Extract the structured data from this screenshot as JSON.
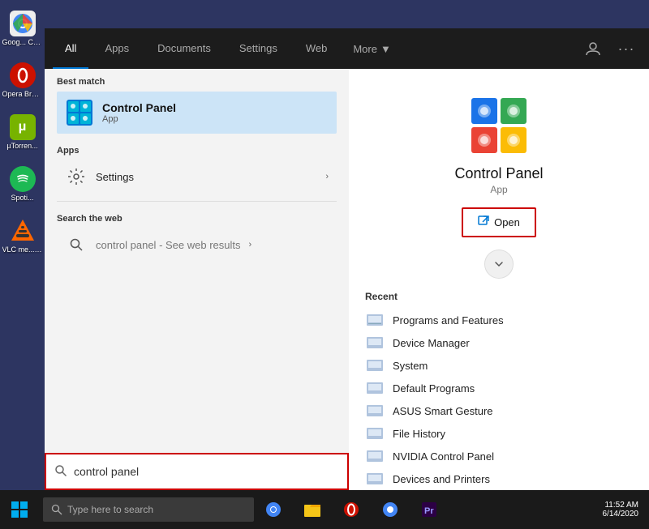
{
  "desktop": {
    "background_color": "#2d3561"
  },
  "taskbar": {
    "time": "11:52 AM",
    "date": "6/14/2020"
  },
  "start_menu": {
    "nav_tabs": [
      {
        "id": "all",
        "label": "All",
        "active": true
      },
      {
        "id": "apps",
        "label": "Apps",
        "active": false
      },
      {
        "id": "documents",
        "label": "Documents",
        "active": false
      },
      {
        "id": "settings",
        "label": "Settings",
        "active": false
      },
      {
        "id": "web",
        "label": "Web",
        "active": false
      }
    ],
    "more_label": "More",
    "sections": {
      "best_match": {
        "header": "Best match",
        "item": {
          "name": "Control Panel",
          "type": "App"
        }
      },
      "apps": {
        "header": "Apps",
        "items": [
          {
            "label": "Settings"
          }
        ]
      },
      "search_web": {
        "header": "Search the web",
        "query": "control panel",
        "suffix": " - See web results"
      }
    },
    "right_panel": {
      "app_name": "Control Panel",
      "app_type": "App",
      "open_button_label": "Open",
      "recent_header": "Recent",
      "recent_items": [
        {
          "label": "Programs and Features"
        },
        {
          "label": "Device Manager"
        },
        {
          "label": "System"
        },
        {
          "label": "Default Programs"
        },
        {
          "label": "ASUS Smart Gesture"
        },
        {
          "label": "File History"
        },
        {
          "label": "NVIDIA Control Panel"
        },
        {
          "label": "Devices and Printers"
        }
      ]
    }
  },
  "search_bar": {
    "value": "control panel",
    "placeholder": "Type here to search"
  },
  "desktop_icons": [
    {
      "id": "chrome",
      "label": "Goog... Chro..."
    },
    {
      "id": "opera",
      "label": "Opera Brows..."
    },
    {
      "id": "utorrent",
      "label": "µTorren..."
    },
    {
      "id": "spotify",
      "label": "Spoti..."
    },
    {
      "id": "vlc",
      "label": "VLC me... playe..."
    }
  ]
}
